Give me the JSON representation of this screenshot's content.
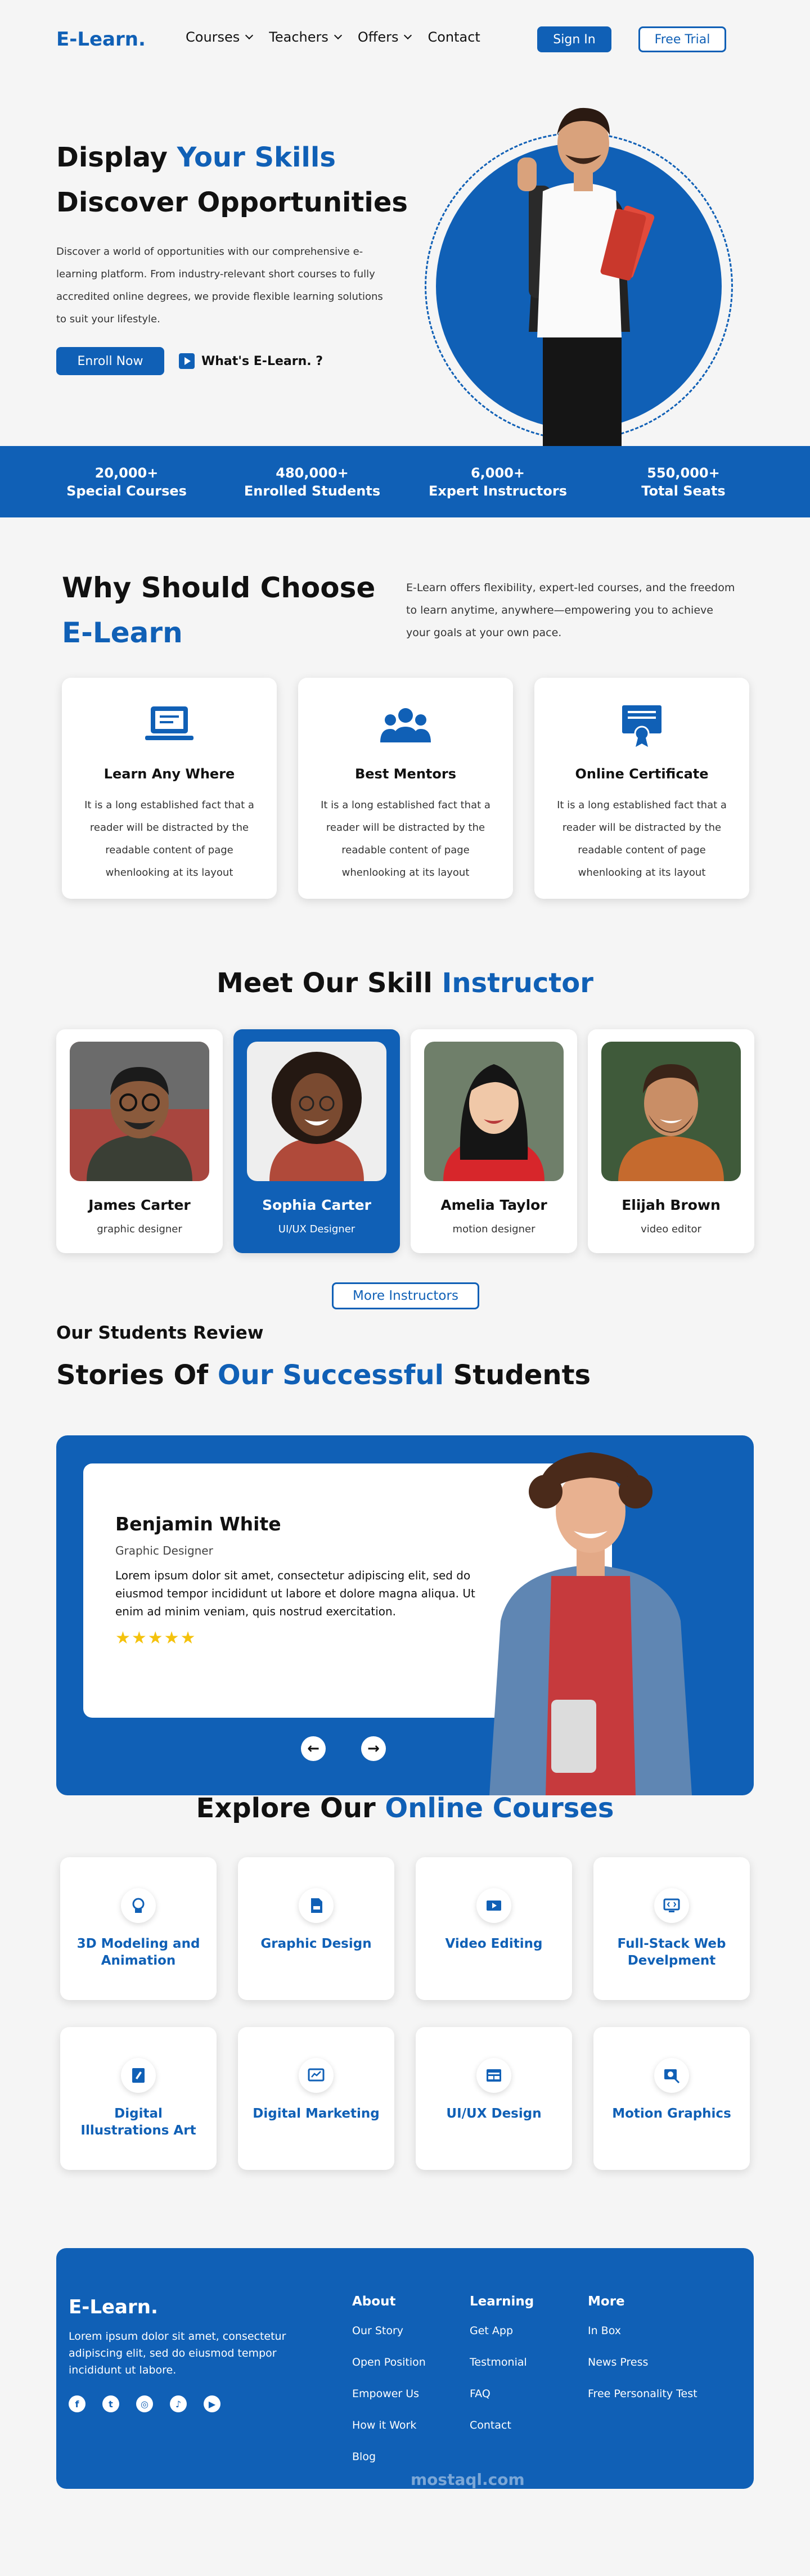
{
  "header": {
    "logo": "E-Learn.",
    "nav": [
      {
        "label": "Courses",
        "dropdown": true
      },
      {
        "label": "Teachers",
        "dropdown": true
      },
      {
        "label": "Offers",
        "dropdown": true
      },
      {
        "label": "Contact",
        "dropdown": false
      }
    ],
    "signin": "Sign In",
    "trial": "Free Trial"
  },
  "hero": {
    "line1_a": "Display ",
    "line1_b": "Your Skills",
    "line2": "Discover Opportunities",
    "desc": "Discover a world of opportunities with our comprehensive e-learning platform. From industry-relevant short courses to fully accredited online degrees, we provide flexible learning solutions to suit your lifestyle.",
    "enroll": "Enroll Now",
    "watch": "What's E-Learn. ?"
  },
  "stats": [
    {
      "value": "20,000+",
      "label": "Special Courses"
    },
    {
      "value": "480,000+",
      "label": "Enrolled Students"
    },
    {
      "value": "6,000+",
      "label": "Expert Instructors"
    },
    {
      "value": "550,000+",
      "label": "Total Seats"
    }
  ],
  "why": {
    "title_a": "Why Should Choose",
    "title_b": "E-Learn",
    "desc": "E-Learn offers flexibility, expert-led courses, and the freedom to learn anytime, anywhere—empowering you to achieve your goals at your own pace.",
    "features": [
      {
        "title": "Learn Any Where",
        "text": "It is a long established fact that a reader will be distracted by the readable content of page whenlooking at its layout",
        "icon": "laptop-icon"
      },
      {
        "title": "Best Mentors",
        "text": "It is a long established fact that a reader will be distracted by the readable content of page whenlooking at its layout",
        "icon": "group-icon"
      },
      {
        "title": "Online Certificate",
        "text": "It is a long established fact that a reader will be distracted by the readable content of page whenlooking at its layout",
        "icon": "certificate-icon"
      }
    ]
  },
  "instructors": {
    "title_a": "Meet Our Skill ",
    "title_b": "Instructor",
    "items": [
      {
        "name": "James Carter",
        "role": "graphic designer"
      },
      {
        "name": "Sophia Carter",
        "role": "UI/UX Designer"
      },
      {
        "name": "Amelia Taylor",
        "role": "motion designer"
      },
      {
        "name": "Elijah Brown",
        "role": "video editor"
      }
    ],
    "more": "More Instructors"
  },
  "review": {
    "sub": "Our Students Review",
    "title_a": "Stories Of ",
    "title_b": "Our Successful",
    "title_c": " Students",
    "name": "Benjamin White",
    "role": "Graphic Designer",
    "text": "Lorem ipsum dolor sit amet, consectetur adipiscing elit, sed do eiusmod tempor incididunt ut labore et dolore magna aliqua. Ut enim ad minim veniam, quis nostrud exercitation.",
    "rating": 5,
    "prev": "←",
    "next": "→"
  },
  "courses": {
    "title_a": "Explore Our ",
    "title_b": "Online Courses",
    "items": [
      {
        "name": "3D Modeling and Animation",
        "icon": "3d-head-icon"
      },
      {
        "name": "Graphic Design",
        "icon": "design-file-icon"
      },
      {
        "name": "Video Editing",
        "icon": "video-icon"
      },
      {
        "name": "Full-Stack Web Develpment",
        "icon": "code-monitor-icon"
      },
      {
        "name": "Digital Illustrations Art",
        "icon": "tablet-pen-icon"
      },
      {
        "name": "Digital Marketing",
        "icon": "chart-monitor-icon"
      },
      {
        "name": "UI/UX Design",
        "icon": "ui-window-icon"
      },
      {
        "name": "Motion Graphics",
        "icon": "motion-icon"
      }
    ]
  },
  "footer": {
    "logo": "E-Learn.",
    "desc": "Lorem ipsum dolor sit amet, consectetur adipiscing elit, sed do eiusmod tempor incididunt ut labore.",
    "columns": [
      {
        "title": "About",
        "links": [
          "Our Story",
          "Open Position",
          "Empower Us",
          "How it Work",
          "Blog"
        ]
      },
      {
        "title": "Learning",
        "links": [
          "Get App",
          "Testmonial",
          "FAQ",
          "Contact"
        ]
      },
      {
        "title": "More",
        "links": [
          "In Box",
          "News Press",
          "Free Personality Test"
        ]
      }
    ],
    "watermark": "mostaql.com"
  },
  "colors": {
    "brand": "#1060b6",
    "star": "#f4c20d"
  }
}
